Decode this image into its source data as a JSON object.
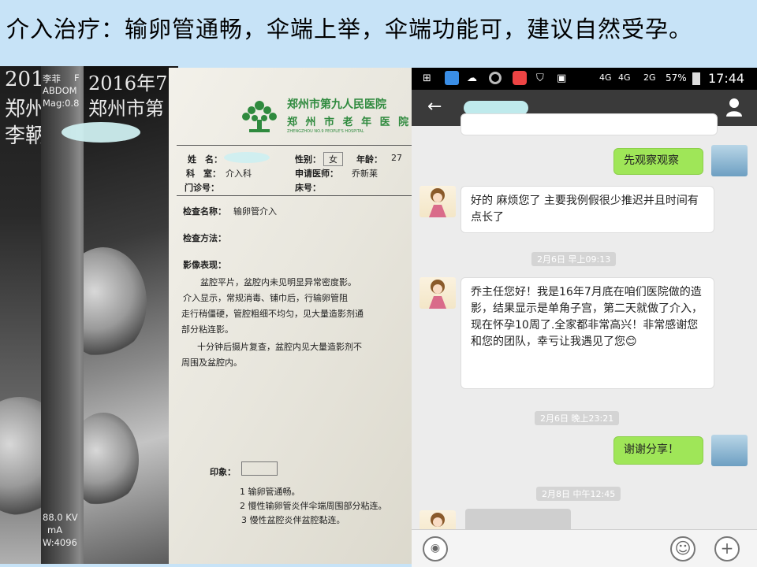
{
  "slide": {
    "title": "介入治疗：输卵管通畅，伞端上举，伞端功能可，建议自然受孕。"
  },
  "xray1": {
    "line1": "201",
    "line2": "郑州",
    "line3": "李鞆"
  },
  "xray2": {
    "header_name": "李菲",
    "header_f": "F",
    "header_abdom": "ABDOM",
    "header_mag": "Mag:0.8",
    "kv": "88.0 KV",
    "ma": "mA",
    "w": "W:4096"
  },
  "xray3": {
    "line1": "2016年7",
    "line2": "郑州市第"
  },
  "report": {
    "hospital_name": "郑州市第九人民医院",
    "hospital_name2": "郑 州 市 老 年 医 院",
    "hospital_en": "ZHENGZHOU NO.9 PEOPLE'S HOSPITAL",
    "name_label": "姓　名：",
    "gender_label": "性别：",
    "gender_value": "女",
    "age_label": "年龄：",
    "age_value": "27",
    "dept_label": "科　室：",
    "dept_value": "介入科",
    "doctor_label": "申请医师：",
    "doctor_value": "乔新莱",
    "clinic_label": "门诊号：",
    "bed_label": "床号：",
    "exam_label": "检查名称：",
    "exam_value": "输卵管介入",
    "method_label": "检查方法：",
    "finding_label": "影像表现：",
    "finding_lines": [
      "盆腔平片，盆腔内未见明显异常密度影。",
      "介入显示，常规消毒、铺巾后，行输卵管阻",
      "走行稍僵硬，管腔粗细不均匀，见大量造影剂通",
      "部分粘连影。",
      "十分钟后摄片复查，盆腔内见大量造影剂不",
      "周围及盆腔内。"
    ],
    "impression_label": "印象：",
    "impression_lines": [
      "1 输卵管通畅。",
      "2 慢性输卵管炎伴伞端周围部分粘连。",
      "3 慢性盆腔炎伴盆腔黏连。"
    ]
  },
  "phone": {
    "status_time": "17:44",
    "status_battery": "57%",
    "status_net1": "4G",
    "status_net2": "4G",
    "status_net3": "2G",
    "messages": [
      {
        "from": "doctor",
        "text": "先观察观察"
      },
      {
        "from": "patient",
        "text": "好的 麻烦您了 主要我例假很少推迟并且时间有点长了"
      },
      {
        "from": "time",
        "text": "2月6日 早上09:13"
      },
      {
        "from": "patient",
        "text": "乔主任您好！我是16年7月底在咱们医院做的造影，结果显示是单角子宫，第二天就做了介入，现在怀孕10周了.全家都非常高兴！非常感谢您和您的团队，幸亏让我遇见了您😊"
      },
      {
        "from": "time",
        "text": "2月6日 晚上23:21"
      },
      {
        "from": "doctor",
        "text": "谢谢分享！"
      },
      {
        "from": "time",
        "text": "2月8日 中午12:45"
      }
    ]
  },
  "colors": {
    "background": "#c7e3f7",
    "bubble_out": "#9fe658",
    "hospital_green": "#2f8a3e"
  }
}
